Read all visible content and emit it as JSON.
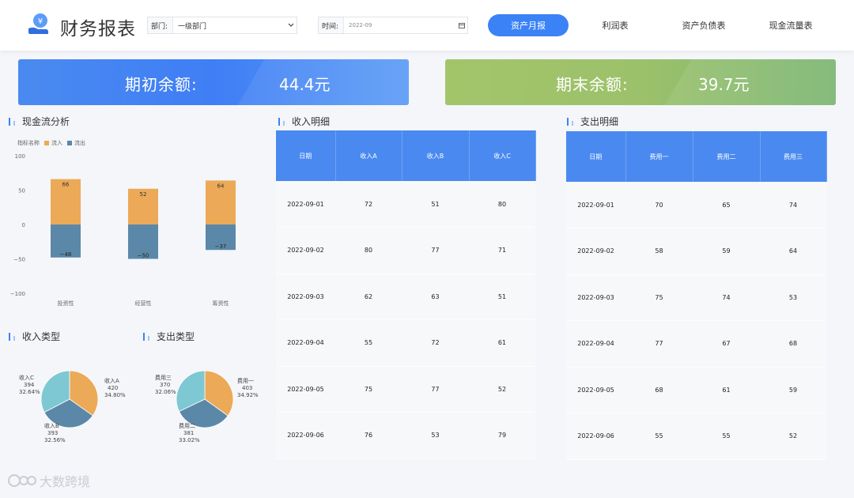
{
  "header": {
    "title": "财务报表",
    "filters": {
      "department": {
        "label": "部门:",
        "value": "一级部门"
      },
      "time": {
        "label": "时间:",
        "value": "2022-09"
      }
    },
    "nav": [
      {
        "label": "资产月报",
        "active": true
      },
      {
        "label": "利润表",
        "active": false
      },
      {
        "label": "资产负债表",
        "active": false
      },
      {
        "label": "现金流量表",
        "active": false
      }
    ]
  },
  "kpis": {
    "opening": {
      "label": "期初余额:",
      "value": "44.4元"
    },
    "closing": {
      "label": "期末余额:",
      "value": "39.7元"
    }
  },
  "cashflow": {
    "title": "现金流分析",
    "legend_title": "指标名称",
    "chart_data": {
      "type": "bar",
      "categories": [
        "投资性",
        "经营性",
        "筹资性"
      ],
      "series": [
        {
          "name": "流入",
          "values": [
            66,
            52,
            64
          ],
          "color": "#eca957"
        },
        {
          "name": "流出",
          "values": [
            -48,
            -50,
            -37
          ],
          "color": "#5b88a8"
        }
      ],
      "ylim": [
        -100,
        100
      ],
      "yticks": [
        100,
        50,
        0,
        -50,
        -100
      ],
      "ytick_labels": [
        "100",
        "50",
        "0",
        "−50",
        "−100"
      ],
      "value_labels": {
        "inflow": [
          "66",
          "52",
          "64"
        ],
        "outflow": [
          "−48",
          "−50",
          "−37"
        ]
      },
      "stacked": true
    }
  },
  "income_detail": {
    "title": "收入明细",
    "columns": [
      "日期",
      "收入A",
      "收入B",
      "收入C"
    ],
    "rows": [
      [
        "2022-09-01",
        "72",
        "51",
        "80"
      ],
      [
        "2022-09-02",
        "80",
        "77",
        "71"
      ],
      [
        "2022-09-03",
        "62",
        "63",
        "51"
      ],
      [
        "2022-09-04",
        "55",
        "72",
        "61"
      ],
      [
        "2022-09-05",
        "75",
        "77",
        "52"
      ],
      [
        "2022-09-06",
        "76",
        "53",
        "79"
      ]
    ]
  },
  "expense_detail": {
    "title": "支出明细",
    "columns": [
      "日期",
      "费用一",
      "费用二",
      "费用三"
    ],
    "rows": [
      [
        "2022-09-01",
        "70",
        "65",
        "74"
      ],
      [
        "2022-09-02",
        "58",
        "59",
        "64"
      ],
      [
        "2022-09-03",
        "75",
        "74",
        "53"
      ],
      [
        "2022-09-04",
        "77",
        "67",
        "68"
      ],
      [
        "2022-09-05",
        "68",
        "61",
        "59"
      ],
      [
        "2022-09-06",
        "55",
        "55",
        "52"
      ]
    ]
  },
  "income_type": {
    "title": "收入类型",
    "chart_data": {
      "type": "pie",
      "slices": [
        {
          "name": "收入A",
          "value": 420,
          "pct": "34.80%",
          "color": "#eca957"
        },
        {
          "name": "收入B",
          "value": 393,
          "pct": "32.56%",
          "color": "#5b88a8"
        },
        {
          "name": "收入C",
          "value": 394,
          "pct": "32.64%",
          "color": "#7ec8d3"
        }
      ]
    }
  },
  "expense_type": {
    "title": "支出类型",
    "chart_data": {
      "type": "pie",
      "slices": [
        {
          "name": "费用一",
          "value": 403,
          "pct": "34.92%",
          "color": "#eca957"
        },
        {
          "name": "费用二",
          "value": 381,
          "pct": "33.02%",
          "color": "#5b88a8"
        },
        {
          "name": "费用三",
          "value": 370,
          "pct": "32.06%",
          "color": "#7ec8d3"
        }
      ]
    }
  },
  "footer": {
    "brand": "大数跨境"
  },
  "colors": {
    "accent": "#3b82f6",
    "inflow": "#eca957",
    "outflow": "#5b88a8",
    "third": "#7ec8d3"
  }
}
